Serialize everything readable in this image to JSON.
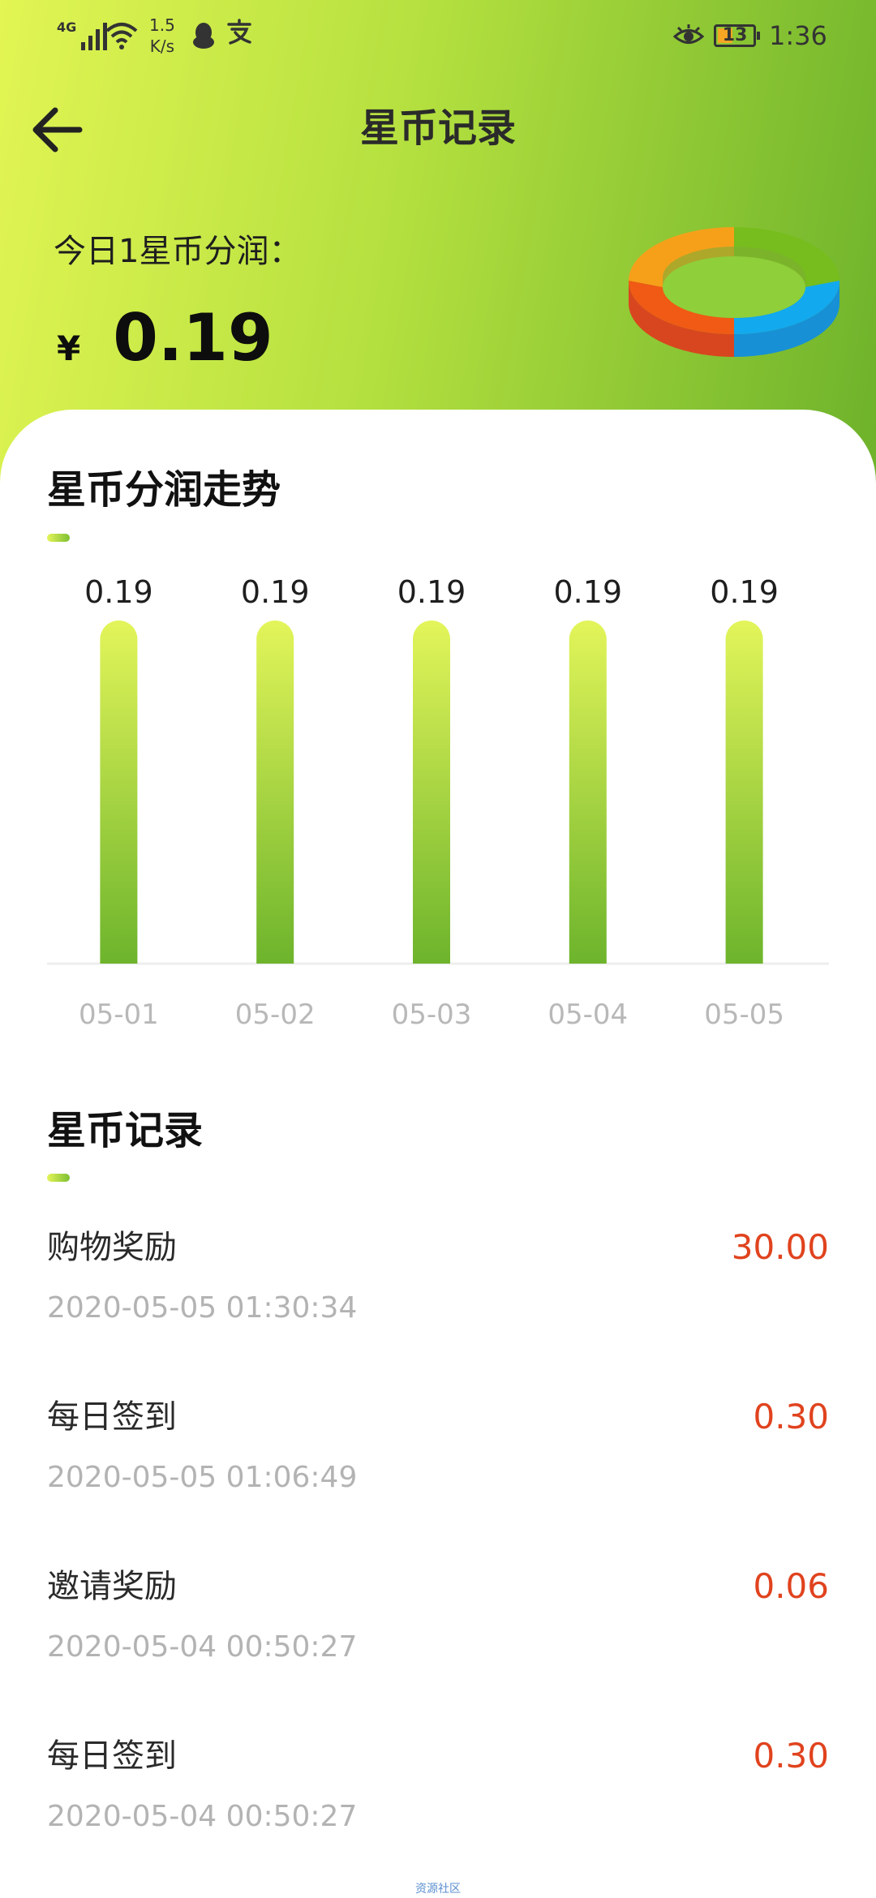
{
  "status_bar": {
    "network": "4G",
    "speed_value": "1.5",
    "speed_unit": "K/s",
    "battery": "13",
    "time": "1:36"
  },
  "header": {
    "title": "星币记录"
  },
  "summary": {
    "label": "今日1星币分润：",
    "currency": "¥",
    "amount": "0.19"
  },
  "trend": {
    "title": "星币分润走势"
  },
  "chart_data": {
    "type": "bar",
    "title": "星币分润走势",
    "categories": [
      "05-01",
      "05-02",
      "05-03",
      "05-04",
      "05-05"
    ],
    "values": [
      0.19,
      0.19,
      0.19,
      0.19,
      0.19
    ],
    "labels": [
      "0.19",
      "0.19",
      "0.19",
      "0.19",
      "0.19"
    ],
    "ylim": [
      0,
      0.19
    ],
    "grid": false,
    "colors": {
      "bar_top": "#e3f55a",
      "bar_bottom": "#6db42c",
      "axis": "#eeeeee"
    }
  },
  "records_section": {
    "title": "星币记录",
    "items": [
      {
        "title": "购物奖励",
        "time": "2020-05-05 01:30:34",
        "amount": "30.00"
      },
      {
        "title": "每日签到",
        "time": "2020-05-05 01:06:49",
        "amount": "0.30"
      },
      {
        "title": "邀请奖励",
        "time": "2020-05-04 00:50:27",
        "amount": "0.06"
      },
      {
        "title": "每日签到",
        "time": "2020-05-04 00:50:27",
        "amount": "0.30"
      }
    ]
  },
  "watermark": "资源社区",
  "icons": {
    "back": "arrow-left-icon",
    "donut": "ring-chart-icon"
  },
  "colors": {
    "accent_green": "#6db22b",
    "amount_red": "#e0431e",
    "muted_text": "#b3b3b3"
  }
}
